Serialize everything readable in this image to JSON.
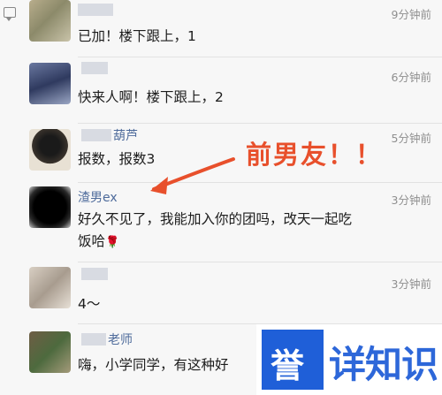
{
  "comments": [
    {
      "name": "",
      "name_suffix": "",
      "time": "9分钟前",
      "text": "已加！楼下跟上，1"
    },
    {
      "name": "",
      "name_suffix": "",
      "time": "6分钟前",
      "text": "快来人啊！楼下跟上，2"
    },
    {
      "name": "",
      "name_suffix": "葫芦",
      "time": "5分钟前",
      "text": "报数，报数3"
    },
    {
      "name": "渣男ex",
      "name_suffix": "",
      "time": "3分钟前",
      "text_line1": "好久不见了，我能加入你的团吗，改天一起吃",
      "text_line2": "饭哈"
    },
    {
      "name": "",
      "name_suffix": "",
      "time": "3分钟前",
      "text": "4～"
    },
    {
      "name": "",
      "name_suffix": "老师",
      "time": "",
      "text": "嗨，小学同学，有这种好"
    }
  ],
  "annotation": {
    "text": "前男友！！",
    "color": "#e8502c"
  },
  "logo": {
    "mark": "誉",
    "text": "详知识"
  },
  "colors": {
    "name": "#4e6b9b",
    "time": "#8f8f8f",
    "brand": "#1f5fd8"
  }
}
